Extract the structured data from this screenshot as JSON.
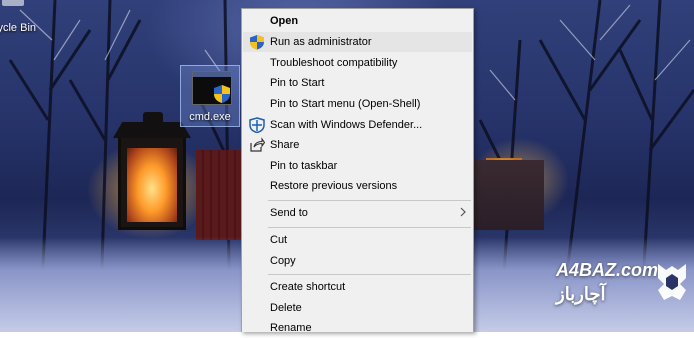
{
  "desktop": {
    "recycle_bin_label": "cycle Bin",
    "cmd_icon_label": "cmd.exe"
  },
  "context_menu": {
    "items": [
      {
        "label": "Open",
        "icon": "",
        "bold": true,
        "highlighted": false
      },
      {
        "label": "Run as administrator",
        "icon": "uac-shield-icon",
        "bold": false,
        "highlighted": true
      },
      {
        "label": "Troubleshoot compatibility",
        "icon": "",
        "bold": false,
        "highlighted": false
      },
      {
        "label": "Pin to Start",
        "icon": "",
        "bold": false,
        "highlighted": false
      },
      {
        "label": "Pin to Start menu (Open-Shell)",
        "icon": "",
        "bold": false,
        "highlighted": false
      },
      {
        "label": "Scan with Windows Defender...",
        "icon": "defender-icon",
        "bold": false,
        "highlighted": false
      },
      {
        "label": "Share",
        "icon": "share-icon",
        "bold": false,
        "highlighted": false
      },
      {
        "label": "Pin to taskbar",
        "icon": "",
        "bold": false,
        "highlighted": false
      },
      {
        "label": "Restore previous versions",
        "icon": "",
        "bold": false,
        "highlighted": false
      },
      {
        "label": "Send to",
        "icon": "chevron-right-icon",
        "bold": false,
        "highlighted": false
      },
      {
        "label": "Cut",
        "icon": "",
        "bold": false,
        "highlighted": false
      },
      {
        "label": "Copy",
        "icon": "",
        "bold": false,
        "highlighted": false
      },
      {
        "label": "Create shortcut",
        "icon": "",
        "bold": false,
        "highlighted": false
      },
      {
        "label": "Delete",
        "icon": "",
        "bold": false,
        "highlighted": false
      },
      {
        "label": "Rename",
        "icon": "",
        "bold": false,
        "highlighted": false
      }
    ]
  },
  "watermark": {
    "brand": "A4BAZ.com",
    "brand_fa": "آچارباز"
  },
  "colors": {
    "menu_bg": "#f0f0f0",
    "menu_highlight": "#e5e5e5",
    "separator": "#c8c8c8"
  }
}
